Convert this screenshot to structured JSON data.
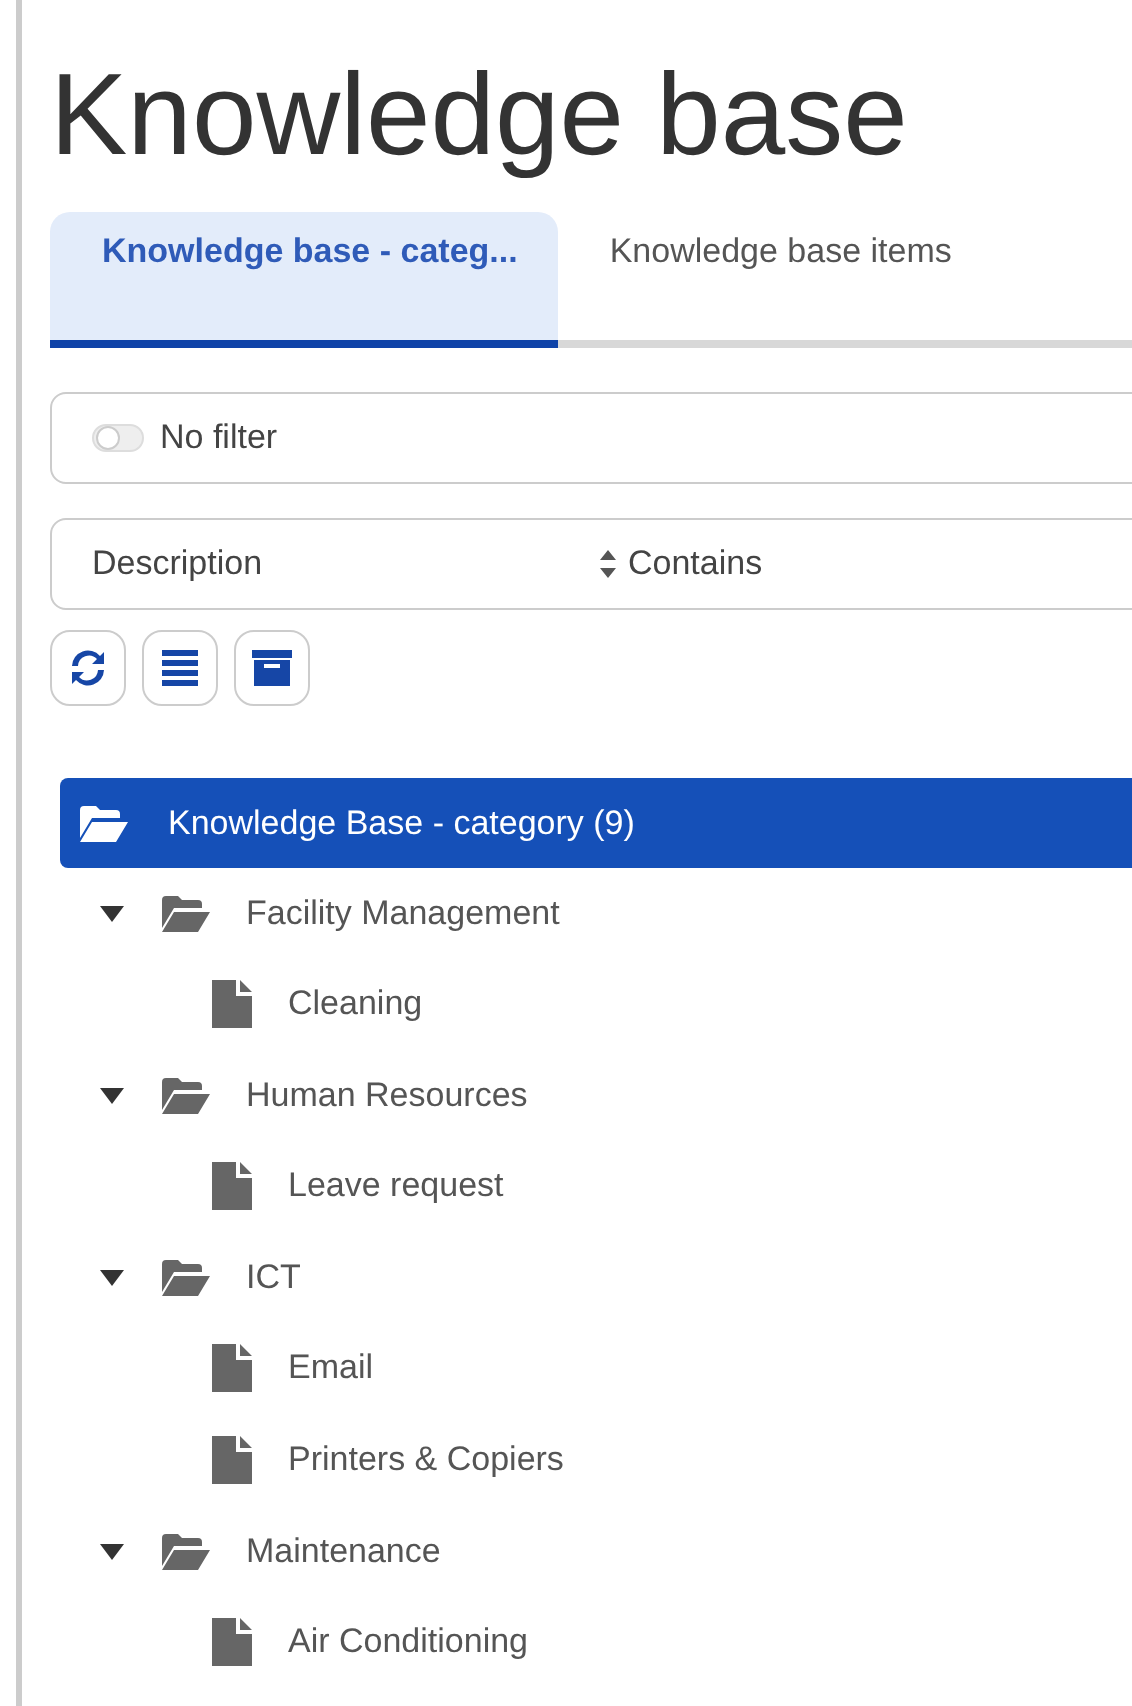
{
  "title": "Knowledge base",
  "tabs": [
    {
      "label": "Knowledge base - categ...",
      "selected": true
    },
    {
      "label": "Knowledge base items",
      "selected": false
    }
  ],
  "filter": {
    "label": "No filter",
    "on": false
  },
  "search": {
    "field": "Description",
    "operator": "Contains"
  },
  "toolbar": [
    {
      "kind": "refresh"
    },
    {
      "kind": "list"
    },
    {
      "kind": "archive"
    }
  ],
  "tree": {
    "label": "Knowledge Base - category (9)",
    "selected": true,
    "children": [
      {
        "label": "Facility Management",
        "expanded": true,
        "selected": false,
        "children": [
          {
            "label": "Cleaning",
            "selected": false
          }
        ]
      },
      {
        "label": "Human Resources",
        "expanded": true,
        "selected": false,
        "children": [
          {
            "label": "Leave request",
            "selected": false
          }
        ]
      },
      {
        "label": "ICT",
        "expanded": true,
        "selected": false,
        "children": [
          {
            "label": "Email",
            "selected": false
          },
          {
            "label": "Printers & Copiers",
            "selected": false
          }
        ]
      },
      {
        "label": "Maintenance",
        "expanded": true,
        "selected": false,
        "children": [
          {
            "label": "Air Conditioning",
            "selected": false
          }
        ]
      }
    ]
  }
}
